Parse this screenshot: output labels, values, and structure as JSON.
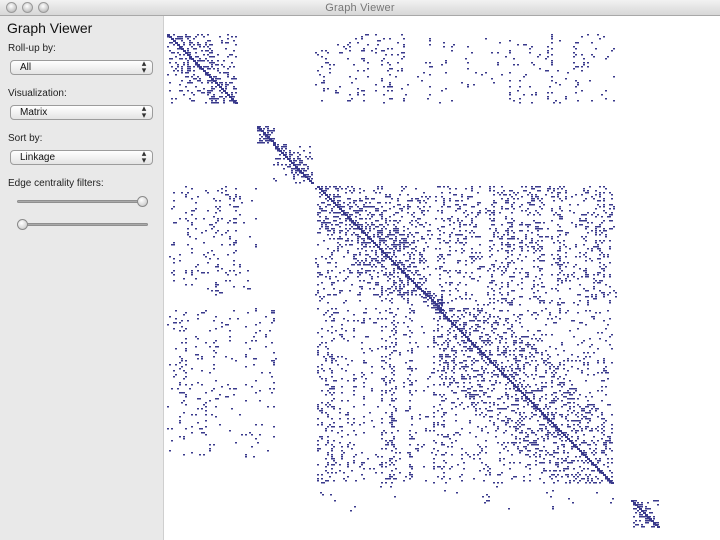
{
  "window": {
    "title": "Graph Viewer"
  },
  "sidebar": {
    "title": "Graph Viewer",
    "rollup": {
      "label": "Roll-up by:",
      "value": "All"
    },
    "visualization": {
      "label": "Visualization:",
      "value": "Matrix"
    },
    "sort": {
      "label": "Sort by:",
      "value": "Linkage"
    },
    "filters": {
      "label": "Edge centrality filters:",
      "max_level": 1.0,
      "min_level": 0.0
    }
  },
  "matrix": {
    "color": "#3a3a8c",
    "view": "adjacency-matrix"
  }
}
